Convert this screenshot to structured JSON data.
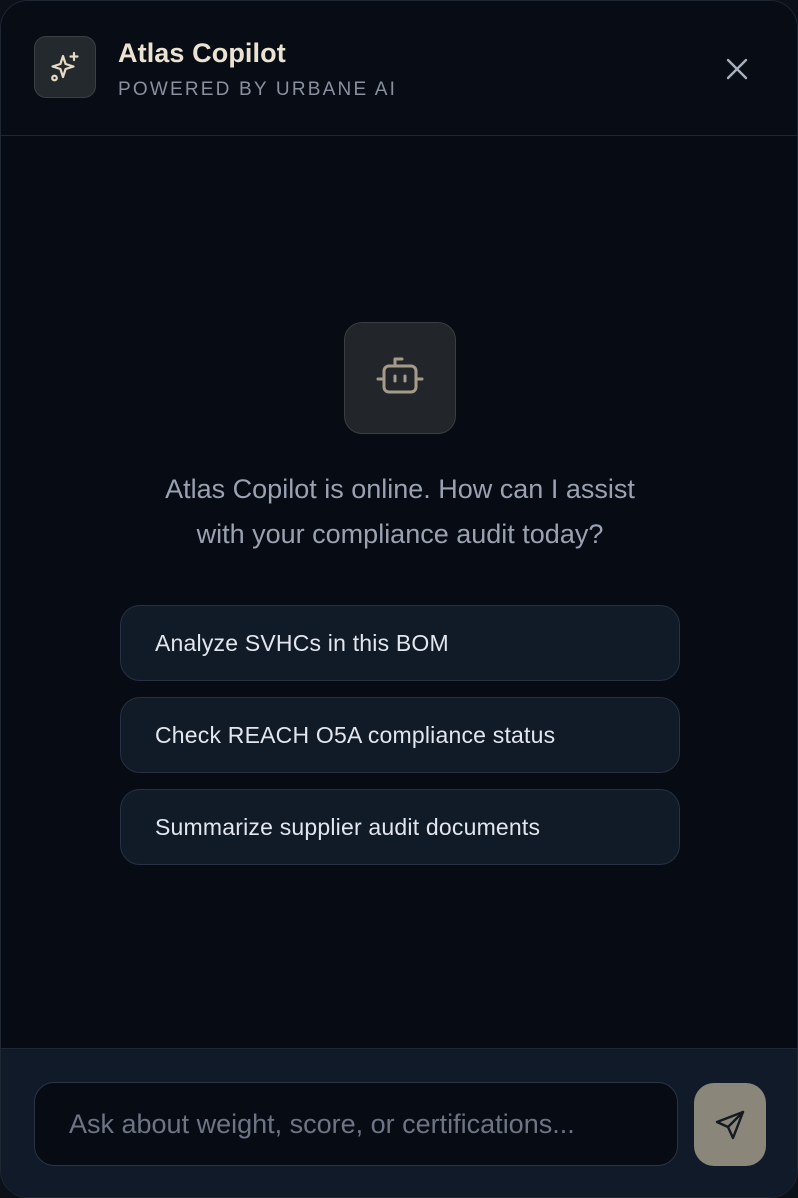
{
  "header": {
    "title": "Atlas Copilot",
    "subtitle": "POWERED BY URBANE AI",
    "logo_icon": "sparkles-icon",
    "close_icon": "close-icon"
  },
  "main": {
    "hero_icon": "bot-icon",
    "welcome_line1": "Atlas Copilot is online. How can I assist",
    "welcome_line2": "with your compliance audit today?",
    "suggestions": [
      {
        "label": "Analyze SVHCs in this BOM"
      },
      {
        "label": "Check REACH O5A compliance status"
      },
      {
        "label": "Summarize supplier audit documents"
      }
    ]
  },
  "composer": {
    "value": "",
    "placeholder": "Ask about weight, score, or certifications...",
    "send_icon": "send-icon"
  },
  "colors": {
    "background": "#070b13",
    "accent": "#8a8679",
    "accent_text": "#eae3d2",
    "chip_background": "#111a27"
  }
}
